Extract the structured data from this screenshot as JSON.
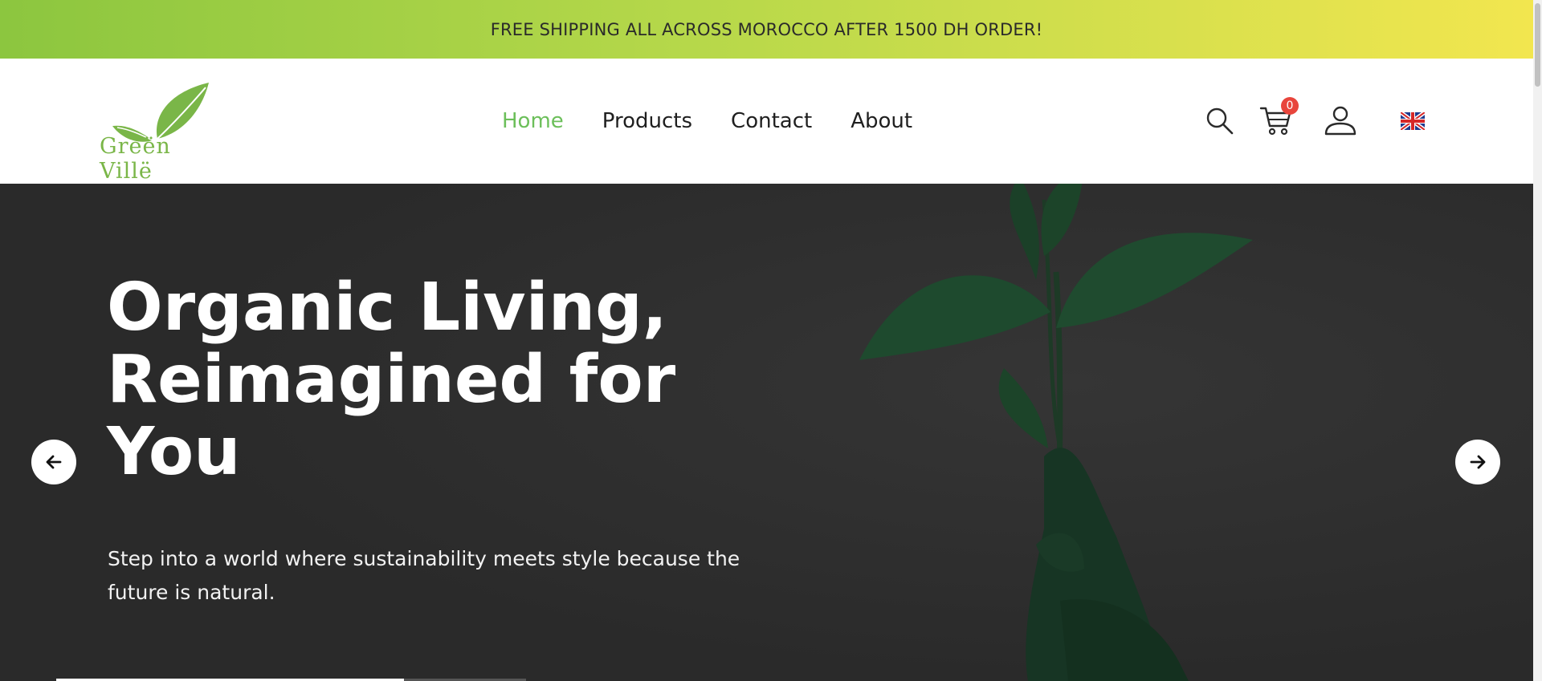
{
  "announcement": {
    "text": "FREE SHIPPING ALL ACROSS MOROCCO AFTER 1500 DH ORDER!"
  },
  "header": {
    "logo_text": "Grëën Villë",
    "nav": [
      {
        "label": "Home",
        "active": true
      },
      {
        "label": "Products",
        "active": false
      },
      {
        "label": "Contact",
        "active": false
      },
      {
        "label": "About",
        "active": false
      }
    ],
    "cart_count": "0",
    "icons": [
      "search-icon",
      "cart-icon",
      "user-icon",
      "uk-flag-icon"
    ]
  },
  "hero": {
    "title": "Organic Living, Reimagined for You",
    "subtitle": "Step into a world where sustainability meets style because the future is natural.",
    "slide_progress": 0.74
  },
  "colors": {
    "accent_green": "#6cbf5a",
    "banner_start": "#8cc63f",
    "banner_end": "#f2e64f",
    "hero_bg": "#2c2c2c",
    "badge_red": "#e8453c"
  }
}
